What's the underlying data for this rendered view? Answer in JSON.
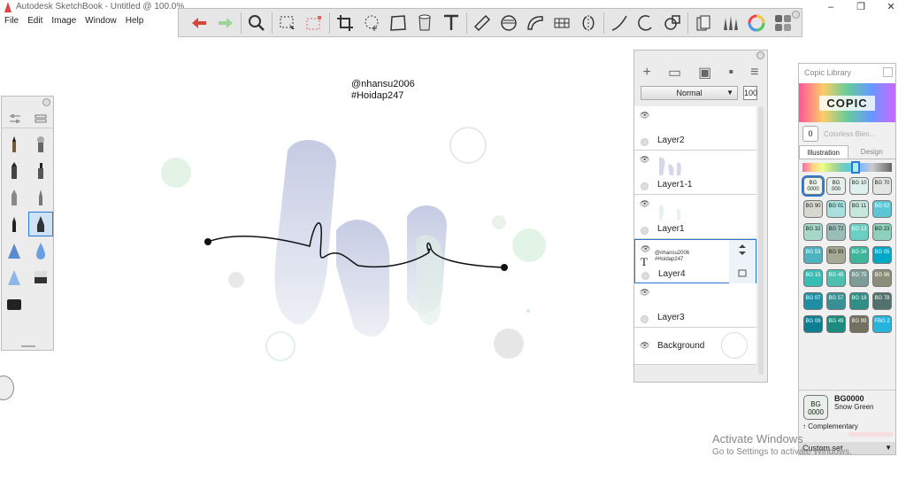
{
  "window": {
    "title": "Autodesk SketchBook - Untitled @ 100.0%",
    "controls": [
      "–",
      "❐",
      "✕"
    ]
  },
  "menu": [
    "File",
    "Edit",
    "Image",
    "Window",
    "Help"
  ],
  "toolbar": {
    "tools": [
      "undo-icon",
      "redo-icon",
      "zoom-icon",
      "select-icon",
      "transform-select-icon",
      "crop-icon",
      "lasso-icon",
      "distort-icon",
      "fill-icon",
      "text-icon",
      "ruler-icon",
      "ellipse-guide-icon",
      "curve-ruler-icon",
      "perspective-icon",
      "symmetry-icon",
      "stroke-icon",
      "ellipse-icon",
      "shape-icon",
      "copic-icon",
      "brush-library-icon",
      "color-wheel-icon",
      "palette-icon"
    ]
  },
  "canvas": {
    "watermark_line1": "@nhansu2006",
    "watermark_line2": "#Hoidap247"
  },
  "layers": {
    "blend_mode": "Normal",
    "opacity": "100",
    "items": [
      {
        "name": "Layer2"
      },
      {
        "name": "Layer1-1"
      },
      {
        "name": "Layer1"
      },
      {
        "name": "Layer4",
        "selected": true,
        "mini1": "@nhansu2006",
        "mini2": "#Hoidap247"
      },
      {
        "name": "Layer3"
      }
    ],
    "background": "Background"
  },
  "copic": {
    "title": "Copic Library",
    "logo": "COPIC",
    "blender_label": "Colorless Blen...",
    "blender_code": "0",
    "tabs": [
      "Illustration",
      "Design"
    ],
    "swatches": [
      {
        "code": "BG 0000",
        "color": "#eef5ee"
      },
      {
        "code": "BG 000",
        "color": "#e6f0ea"
      },
      {
        "code": "BG 10",
        "color": "#ddf0ec"
      },
      {
        "code": "BG 70",
        "color": "#e2e6e2"
      },
      {
        "code": "BG 90",
        "color": "#d7d8cf"
      },
      {
        "code": "BG 01",
        "color": "#a9e0dd"
      },
      {
        "code": "BG 11",
        "color": "#c7e7dd"
      },
      {
        "code": "BG 02",
        "color": "#5fc6d4"
      },
      {
        "code": "BG 32",
        "color": "#a6d7c9"
      },
      {
        "code": "BG 72",
        "color": "#9bbdba"
      },
      {
        "code": "BG 13",
        "color": "#6ccfc3"
      },
      {
        "code": "BG 23",
        "color": "#8fd0bd"
      },
      {
        "code": "BG 53",
        "color": "#4db3c0"
      },
      {
        "code": "BG 93",
        "color": "#a5a894"
      },
      {
        "code": "BG 34",
        "color": "#3fb59c"
      },
      {
        "code": "BG 05",
        "color": "#00a8c6"
      },
      {
        "code": "BG 15",
        "color": "#38bcb6"
      },
      {
        "code": "BG 45",
        "color": "#4dbfae"
      },
      {
        "code": "BG 75",
        "color": "#7c9c98"
      },
      {
        "code": "BG 96",
        "color": "#8c8d79"
      },
      {
        "code": "BG 07",
        "color": "#1e8fa3"
      },
      {
        "code": "BG 57",
        "color": "#3a8f94"
      },
      {
        "code": "BG 18",
        "color": "#2f8f86"
      },
      {
        "code": "BG 78",
        "color": "#52706c"
      },
      {
        "code": "BG 09",
        "color": "#0e7e93"
      },
      {
        "code": "BG 49",
        "color": "#1c8b7d"
      },
      {
        "code": "BG 99",
        "color": "#72705e"
      },
      {
        "code": "FBG 2",
        "color": "#26b4dc"
      }
    ],
    "current_code": "BG0000",
    "current_name": "Snow Green",
    "current_swatch": "BG 0000",
    "complementary": "Complementary",
    "custom_set": "Custom set"
  },
  "activation": {
    "line1": "Activate Windows",
    "line2": "Go to Settings to activate Windows."
  }
}
